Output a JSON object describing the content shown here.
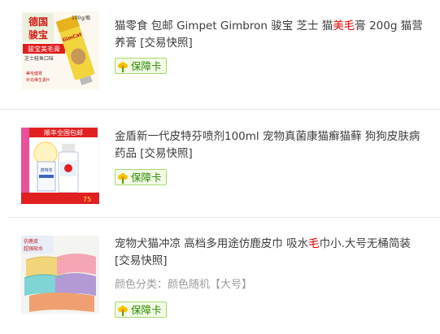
{
  "items": [
    {
      "title_pre": "猫零食 包邮 Gimpet Gimbron 骏宝 芝士 猫",
      "title_hl": "美毛",
      "title_post": "膏 200g 猫营养膏 [交易快照]",
      "spec": "",
      "badge_label": "保障卡",
      "image_alt": "德国骏宝 骏宝美毛膏 芝士鲑鱼口味 100g/瓶",
      "image_text": {
        "brand_line1": "德国",
        "brand_line2": "骏宝",
        "banner": "骏宝美毛膏",
        "sub": "芝士鲑鱼口味",
        "weight": "100g/瓶",
        "note1": "美毛健胃",
        "note2": "补充维生素H",
        "logo": "GimCat"
      }
    },
    {
      "title_pre": "金盾新一代皮特芬喷剂100ml 宠物真菌康猫癣猫藓 狗狗皮肤病药品 [交易快照]",
      "title_hl": "",
      "title_post": "",
      "spec": "",
      "badge_label": "保障卡",
      "image_alt": "皮特芬喷剂",
      "image_text": {
        "banner": "顺丰全国包邮",
        "product": "皮特芬",
        "price": "75"
      }
    },
    {
      "title_pre": "宠物犬猫冲凉 高档多用途仿鹿皮巾 吸水",
      "title_hl": "毛",
      "title_post": "巾小.大号无桶简装 [交易快照]",
      "spec": "颜色分类：颜色随机【大号】",
      "badge_label": "保障卡",
      "image_alt": "仿鹿皮吸水巾",
      "image_text": {
        "tag1": "仿鹿皮",
        "tag2": "超强吸水"
      }
    }
  ],
  "colors": {
    "highlight": "#f40000",
    "badge_text": "#2b8a00",
    "badge_border": "#a9d86e",
    "spec_text": "#9c9c9c"
  }
}
